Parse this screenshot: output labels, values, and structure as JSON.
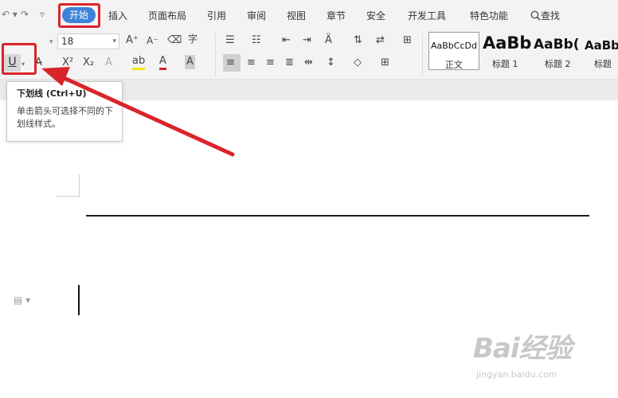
{
  "menubar": {
    "quick_access": [
      "↶ ▾",
      "↷",
      "▿"
    ],
    "active_tab": "开始",
    "tabs": [
      "插入",
      "页面布局",
      "引用",
      "审阅",
      "视图",
      "章节",
      "安全",
      "开发工具",
      "特色功能"
    ],
    "search_label": "查找"
  },
  "ribbon": {
    "font_size_value": "18",
    "underline_glyph": "U",
    "styles": [
      {
        "preview": "AaBbCcDd",
        "name": "正文"
      },
      {
        "preview": "AaBb",
        "name": "标题 1"
      },
      {
        "preview": "AaBb(",
        "name": "标题 2"
      },
      {
        "preview": "AaBb",
        "name": "标题"
      }
    ]
  },
  "tooltip": {
    "title": "下划线 (Ctrl+U)",
    "description": "单击箭头可选择不同的下划线样式。"
  },
  "watermark": {
    "brand": "Bai经验",
    "url": "jingyan.baidu.com"
  },
  "colors": {
    "accent_blue": "#3d82d9",
    "annotation_red": "#d9252a",
    "highlight_yellow": "#f2e31b",
    "font_color_red": "#d9252a"
  },
  "icons": [
    "undo-icon",
    "redo-icon",
    "search-icon",
    "underline-icon",
    "strikethrough-icon",
    "superscript-icon",
    "subscript-icon",
    "highlight-icon",
    "font-color-icon",
    "align-left-icon",
    "align-center-icon",
    "align-right-icon",
    "justify-icon",
    "bullet-list-icon",
    "numbered-list-icon",
    "border-icon",
    "paragraph-icon"
  ]
}
